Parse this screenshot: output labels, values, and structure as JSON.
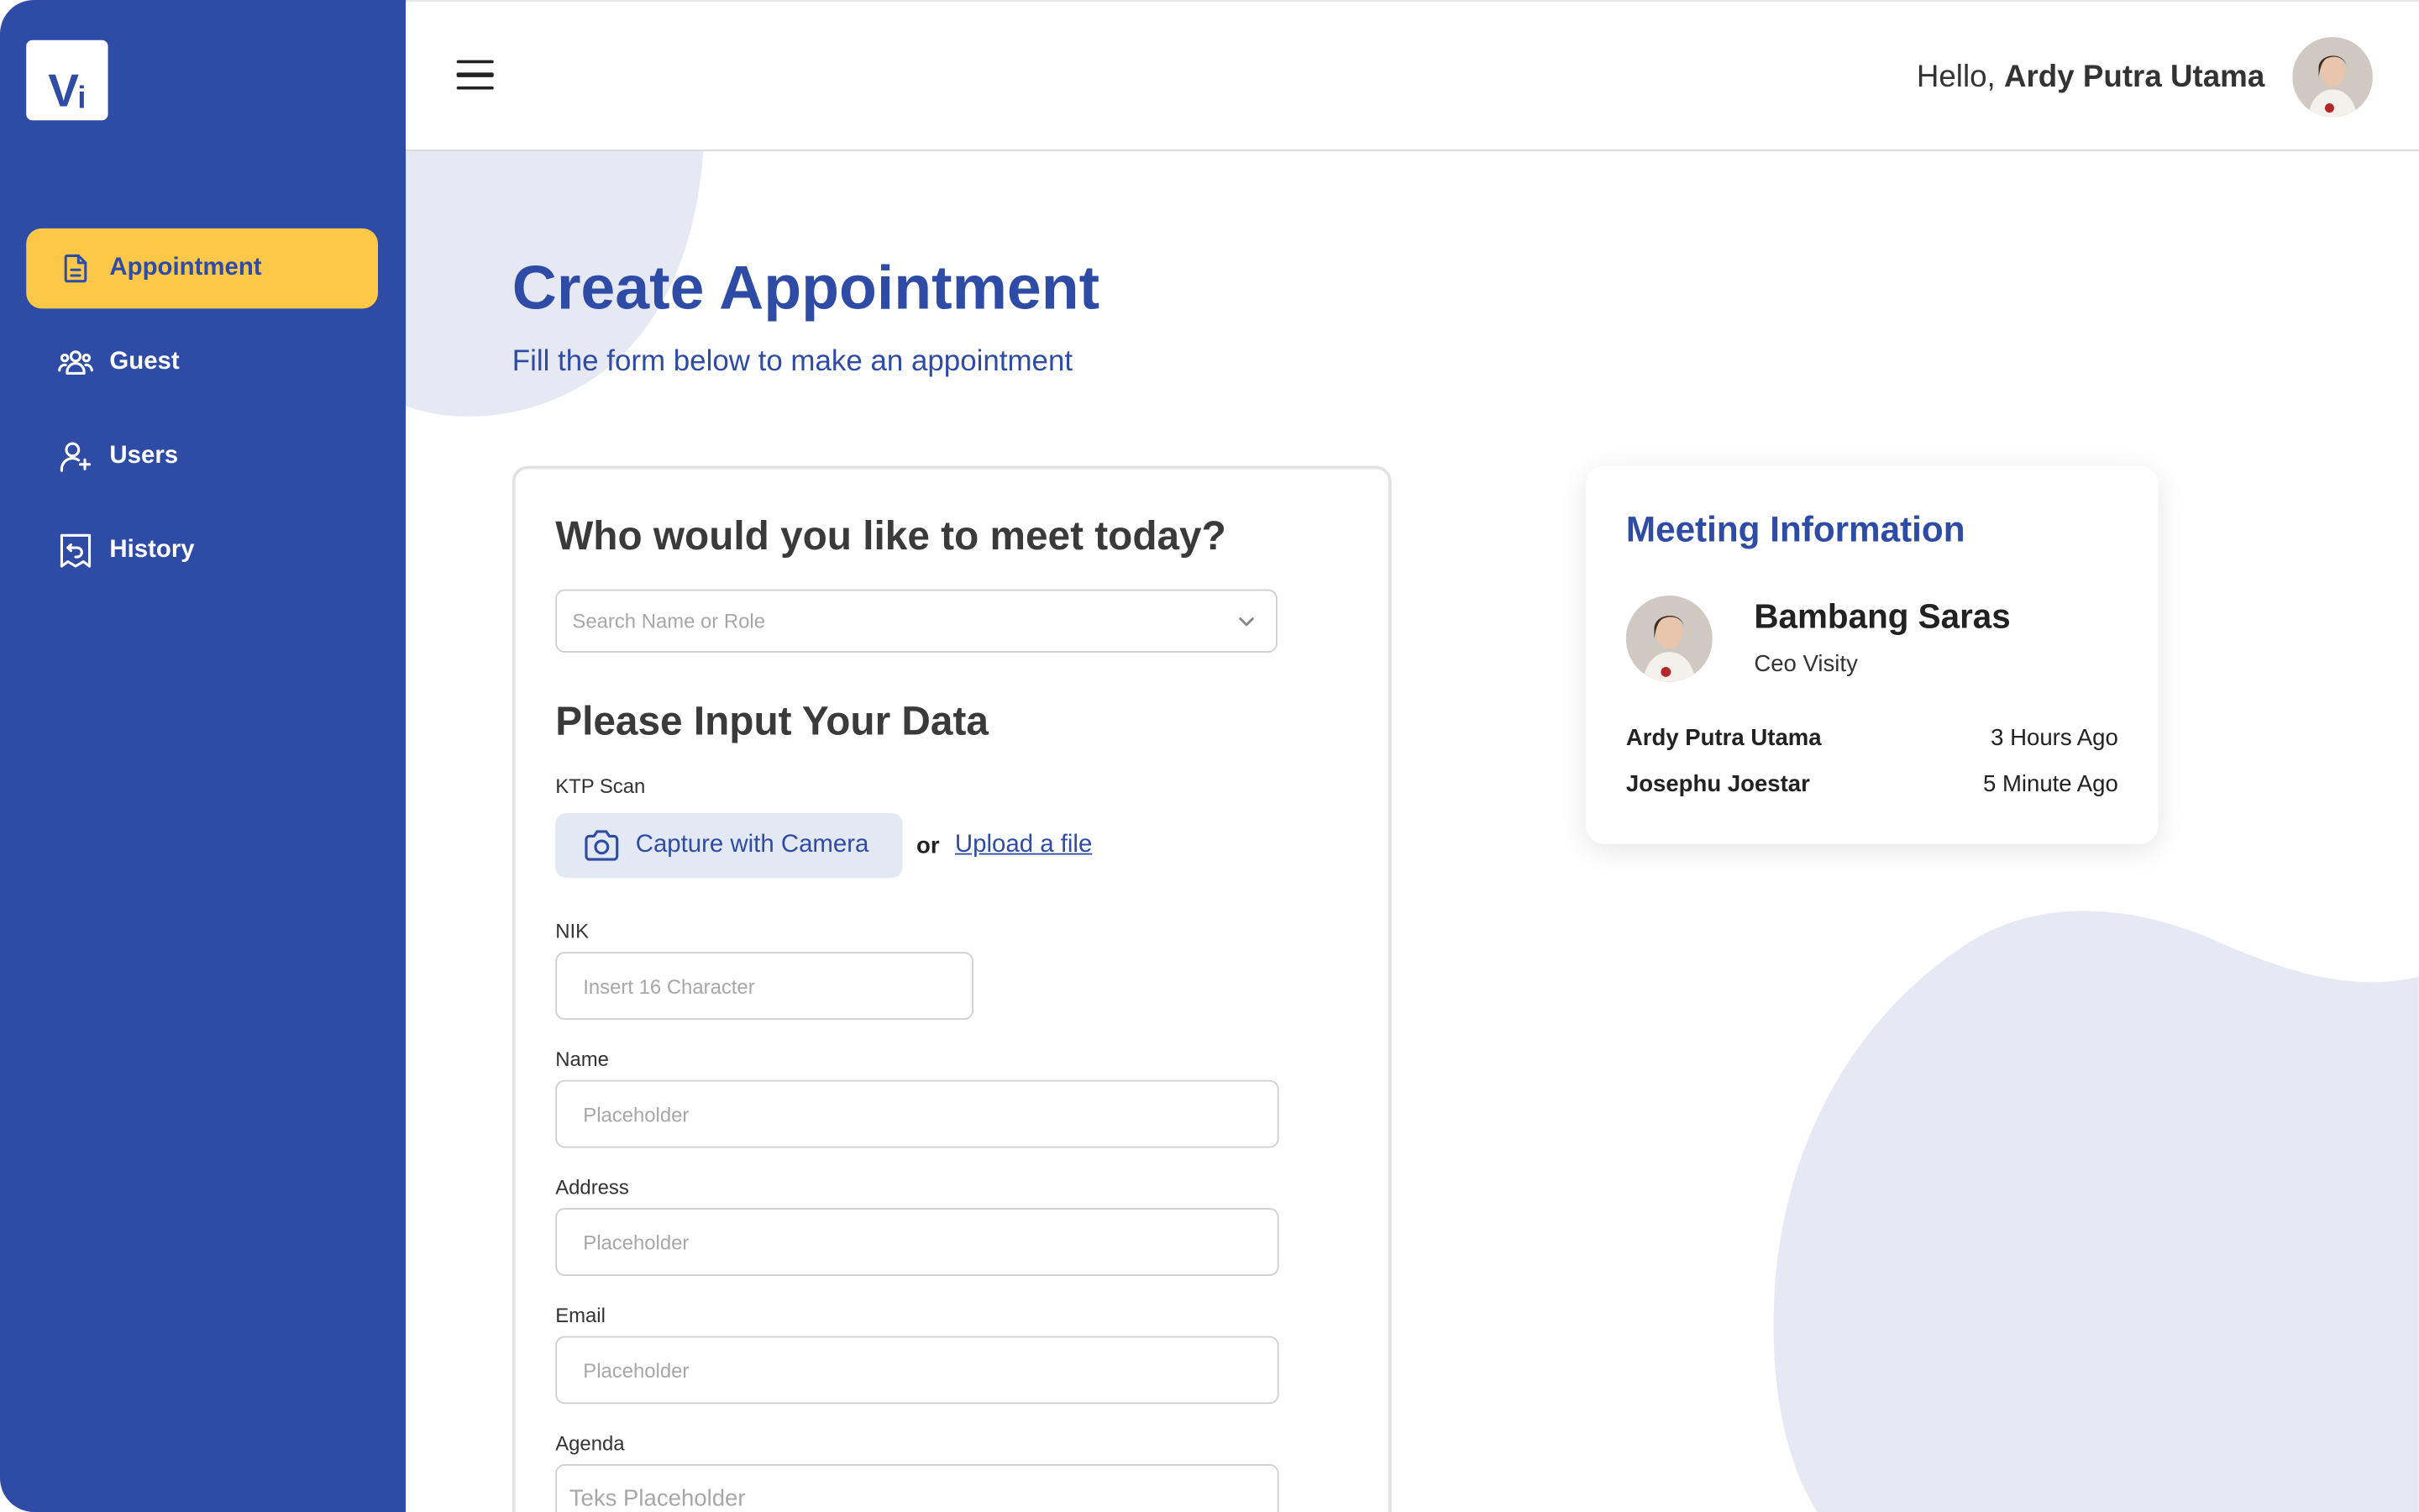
{
  "app": {
    "logo_main": "V",
    "logo_sub": "i"
  },
  "sidebar": {
    "items": [
      {
        "label": "Appointment",
        "icon": "document-icon",
        "active": true
      },
      {
        "label": "Guest",
        "icon": "users-group-icon",
        "active": false
      },
      {
        "label": "Users",
        "icon": "user-add-icon",
        "active": false
      },
      {
        "label": "History",
        "icon": "history-icon",
        "active": false
      }
    ]
  },
  "header": {
    "greeting_prefix": "Hello,",
    "user_name": "Ardy Putra Utama"
  },
  "main": {
    "title": "Create Appointment",
    "subtitle": "Fill the form below to make an appointment"
  },
  "form": {
    "meet_heading": "Who would you like to meet today?",
    "search_placeholder": "Search Name or Role",
    "data_heading": "Please Input Your Data",
    "ktp_label": "KTP Scan",
    "camera_button": "Capture with Camera",
    "or_text": "or",
    "upload_link": "Upload a file",
    "nik_label": "NIK",
    "nik_placeholder": "Insert 16 Character",
    "name_label": "Name",
    "name_placeholder": "Placeholder",
    "address_label": "Address",
    "address_placeholder": "Placeholder",
    "email_label": "Email",
    "email_placeholder": "Placeholder",
    "agenda_label": "Agenda",
    "agenda_placeholder": "Teks Placeholder"
  },
  "meeting_info": {
    "title": "Meeting Information",
    "host_name": "Bambang Saras",
    "host_role": "Ceo Visity",
    "logs": [
      {
        "name": "Ardy Putra Utama",
        "time": "3 Hours Ago"
      },
      {
        "name": "Josephu Joestar",
        "time": "5 Minute Ago"
      }
    ]
  },
  "colors": {
    "primary": "#2e4ba6",
    "accent": "#fdc847",
    "blob": "#e6e9f4"
  }
}
